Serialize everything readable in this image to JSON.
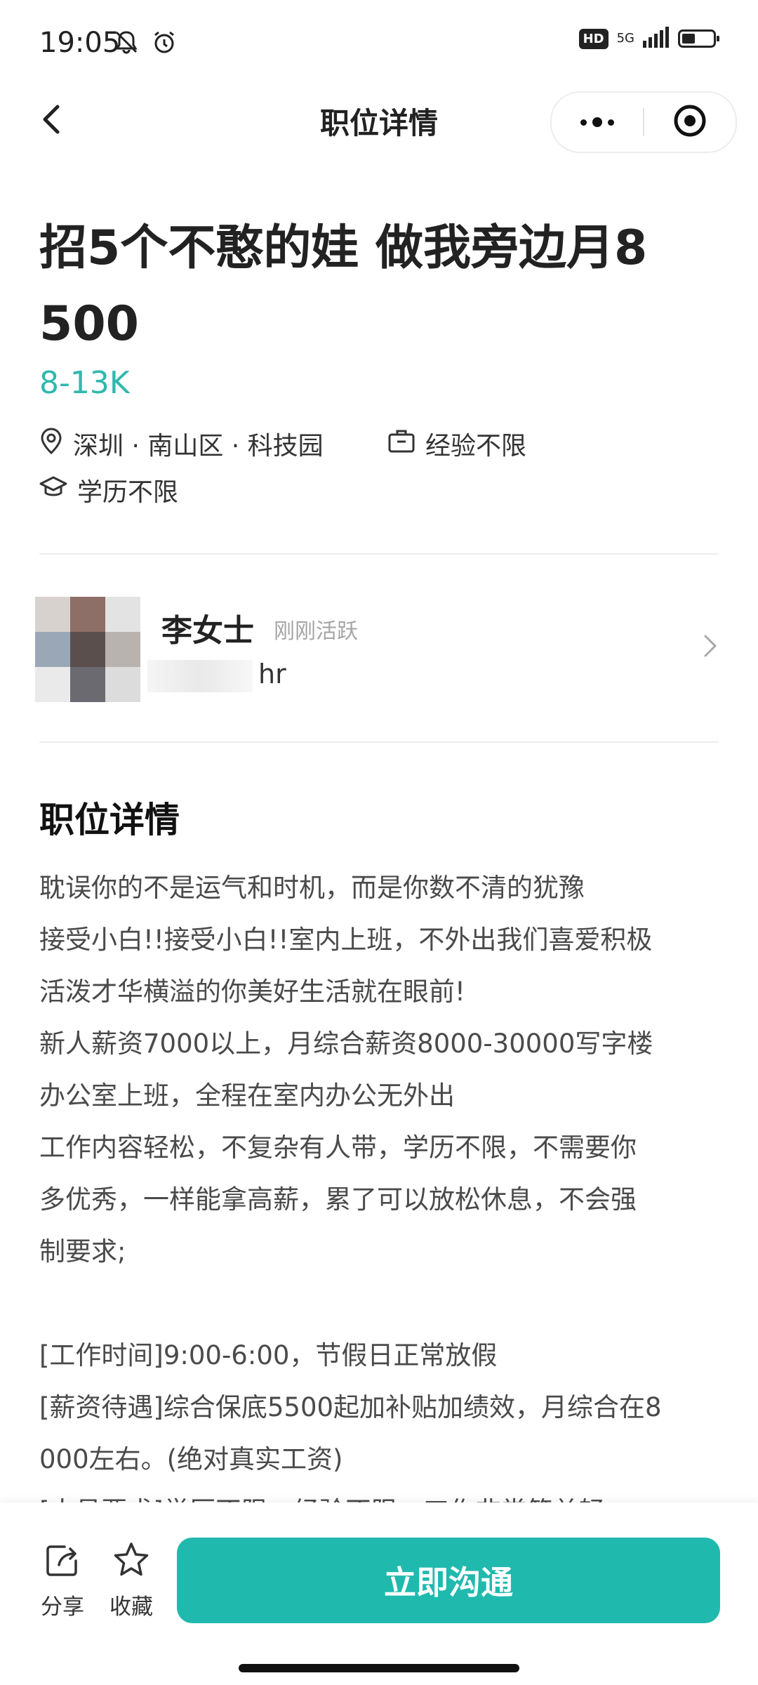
{
  "status_bar": {
    "time": "19:05",
    "hd": "HD",
    "network": "5G",
    "icons": [
      "bell-off-icon",
      "alarm-icon",
      "signal-icon",
      "battery-icon"
    ]
  },
  "nav": {
    "title": "职位详情",
    "icons": [
      "back-icon",
      "more-icon",
      "target-icon"
    ]
  },
  "job": {
    "title": "招5个不憨的娃 做我旁边月8500",
    "title_line1": "招5个不憨的娃 做我旁边月8",
    "title_line2": "500",
    "salary": "8-13K",
    "location": "深圳 · 南山区 · 科技园",
    "experience": "经验不限",
    "education": "学历不限"
  },
  "recruiter": {
    "name": "李女士",
    "active_status": "刚刚活跃",
    "role": "hr"
  },
  "details": {
    "title": "职位详情",
    "lines": [
      "耽误你的不是运气和时机，而是你数不清的犹豫",
      "接受小白!!接受小白!!室内上班，不外出我们喜爱积极",
      "活泼才华横溢的你美好生活就在眼前!",
      "新人薪资7000以上，月综合薪资8000-30000写字楼",
      "办公室上班，全程在室内办公无外出",
      "工作内容轻松，不复杂有人带，学历不限，不需要你",
      "多优秀，一样能拿高薪，累了可以放松休息，不会强",
      "制要求;",
      "",
      "[工作时间]9:00-6:00，节假日正常放假",
      "[薪资待遇]综合保底5500起加补贴加绩效，月综合在8",
      "000左右。(绝对真实工资)",
      "[人员要求]学历不限，经验不限，工作非常简单轻"
    ]
  },
  "bottom_bar": {
    "share": "分享",
    "favorite": "收藏",
    "chat_button": "立即沟通"
  },
  "colors": {
    "accent": "#20b9ae",
    "salary": "#2fb8ae"
  }
}
